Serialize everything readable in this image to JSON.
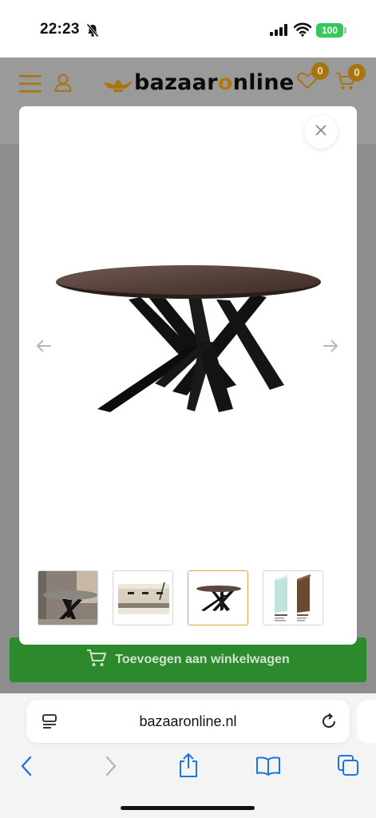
{
  "status_bar": {
    "time": "22:23",
    "battery": "100",
    "icons": [
      "bell-slash-icon",
      "signal-icon",
      "wifi-icon",
      "battery-icon"
    ]
  },
  "header": {
    "logo_prefix": "bazaar",
    "logo_accent": "o",
    "logo_suffix": "nline",
    "wishlist_count": "0",
    "cart_count": "0",
    "brand_color": "#b07a12"
  },
  "product_bar": {
    "add_to_cart_label": "Toevoegen aan winkelwagen",
    "color": "#2c8a2d"
  },
  "lightbox": {
    "active_thumbnail": 3,
    "thumbnail_count": 4,
    "active_border_color": "#e3a23a"
  },
  "browser": {
    "url": "bazaaronline.nl",
    "accent_color": "#1a73e8"
  }
}
